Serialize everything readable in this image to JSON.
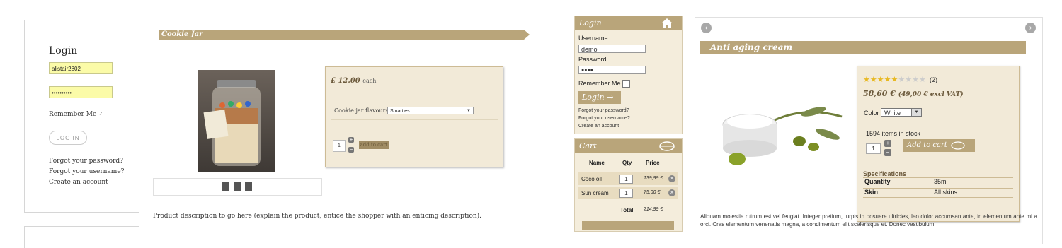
{
  "left_login": {
    "title": "Login",
    "username_value": "alistair2802",
    "password_value": "••••••••••",
    "remember_label": "Remember Me",
    "login_button": "LOG IN",
    "links": [
      "Forgot your password?",
      "Forgot your username?",
      "Create an account"
    ]
  },
  "cookie_jar": {
    "title": "Cookie Jar",
    "price": "£ 12.00",
    "price_suffix": "each",
    "flavour_label": "Cookie jar flavours",
    "flavour_selected": "Smarties",
    "quantity": "1",
    "add_to_cart": "add to cart",
    "description": "Product description to go here (explain the product, entice the shopper with an enticing description)."
  },
  "module_login": {
    "title": "Login",
    "username_label": "Username",
    "username_value": "demo",
    "password_label": "Password",
    "password_value": "●●●●",
    "remember_label": "Remember Me",
    "login_button": "Login",
    "links": [
      "Forgot your password?",
      "Forgot your username?",
      "Create an account"
    ]
  },
  "cart": {
    "title": "Cart",
    "headers": [
      "Name",
      "Qty",
      "Price"
    ],
    "rows": [
      {
        "name": "Coco oil",
        "qty": "1",
        "price": "139,99 €"
      },
      {
        "name": "Sun cream",
        "qty": "1",
        "price": "75,00 €"
      }
    ],
    "total_label": "Total",
    "total_value": "214,99 €"
  },
  "product": {
    "title": "Anti aging cream",
    "rating": 5,
    "rating_max": 9,
    "review_count": "(2)",
    "price": "58,60 €",
    "price_excl": "(49,00 € excl VAT)",
    "color_label": "Color",
    "color_selected": "White",
    "stock_text": "1594 items in stock",
    "quantity": "1",
    "add_to_cart": "Add to cart",
    "specs_title": "Specifications",
    "specs": [
      {
        "key": "Quantity",
        "value": "35ml"
      },
      {
        "key": "Skin",
        "value": "All skins"
      }
    ],
    "description": "Aliquam molestie rutrum est vel feugiat. Integer pretium, turpis in posuere ultricies, leo dolor accumsan ante, in elementum ante mi a orci. Cras elementum venenatis magna, a condimentum elit scelerisque et. Donec vestibulum"
  },
  "colors": {
    "accent": "#b9a57a",
    "panel_bg": "#f2ead8",
    "autofill": "#fbfba8"
  }
}
